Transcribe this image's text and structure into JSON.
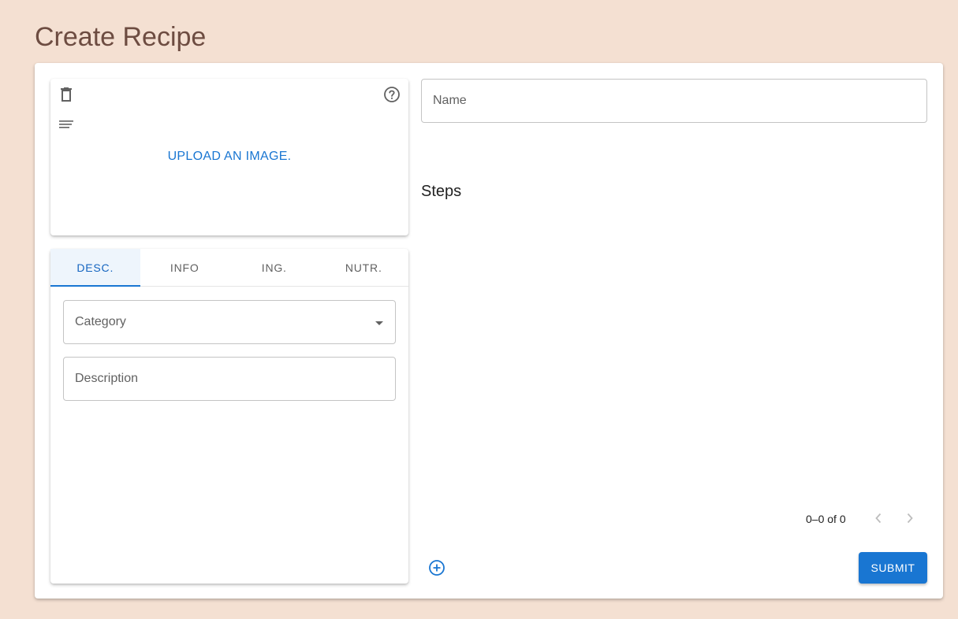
{
  "page": {
    "title": "Create Recipe"
  },
  "image_panel": {
    "upload_label": "UPLOAD AN IMAGE.",
    "icons": {
      "delete": "trash-icon",
      "help": "help-circle-icon",
      "sort": "sort-lines-icon"
    }
  },
  "tabs": [
    {
      "label": "DESC.",
      "active": true
    },
    {
      "label": "INFO",
      "active": false
    },
    {
      "label": "ING.",
      "active": false
    },
    {
      "label": "NUTR.",
      "active": false
    }
  ],
  "description_tab": {
    "category": {
      "label": "Category",
      "value": ""
    },
    "description": {
      "label": "Description",
      "value": ""
    }
  },
  "name_field": {
    "label": "Name",
    "value": ""
  },
  "steps": {
    "heading": "Steps",
    "pagination": "0–0 of 0",
    "add_icon": "add-circle-icon"
  },
  "actions": {
    "submit_label": "SUBMIT"
  },
  "colors": {
    "background": "#f4e0d2",
    "title": "#6d4c41",
    "accent": "#1976d2"
  }
}
